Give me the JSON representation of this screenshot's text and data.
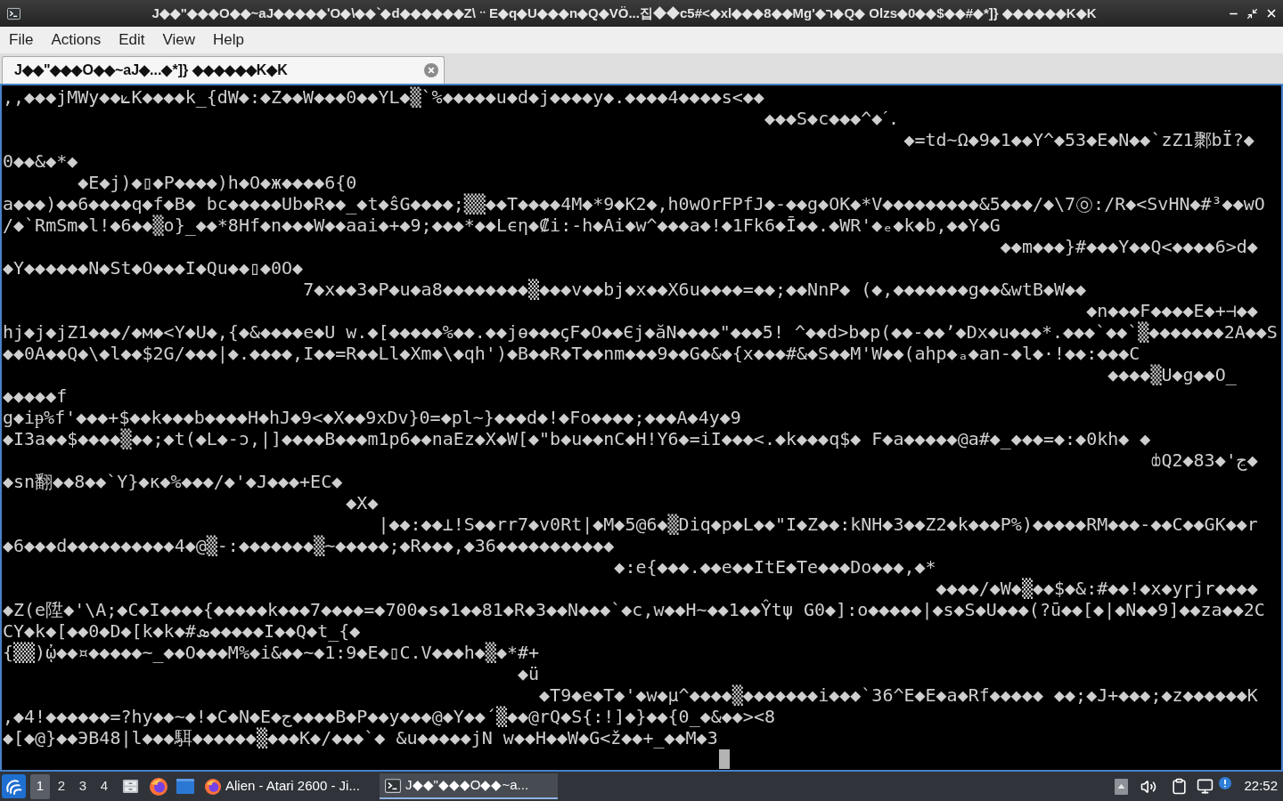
{
  "window": {
    "title": "J◆◆\"◆◆◆O◆◆~aJ◆◆◆◆◆ʹO◆\\◆◆`◆d◆◆◆◆◆◆Z\\ᆢE◆q◆U◆◆◆n◆Q◆VÖ...집◆◆c5#<◆xl◆◆◆8◆◆Mg'◆ר◆Q◆ Olzs◆0◆◆$◆◆#◆*]} ◆◆◆◆◆◆K◆K"
  },
  "menu": [
    "File",
    "Actions",
    "Edit",
    "View",
    "Help"
  ],
  "tabs": [
    {
      "label": "J◆◆\"◆◆◆O◆◆~aJ◆...◆*]} ◆◆◆◆◆◆K◆K",
      "selected": true
    }
  ],
  "terminal": {
    "lines": [
      ",,◆◆◆jMWy◆◆⟀K◆◆◆◆k_{dW◆:◆Z◆◆W◆◆◆0◆◆YL◆▒`%◆◆◆◆◆u◆d◆j◆◆◆◆y◆.◆◆◆◆4◆◆◆◆s<◆◆",
      "                                                                       ◆◆◆S◆c◆◆◆^◆ˊ.",
      "                                                                                    ◆=td~Ω◆9◆1◆◆Y^◆53◆E◆N◆◆`zZ1鄹bÏ?◆",
      "0◆◆&◆*◆",
      "       ◆E◆j)◆▯◆P◆◆◆◆)h◆O◆ж◆◆◆◆6{0",
      "a◆◆◆)◆◆6◆◆◆◆q◆f◆B◆ bc◆◆◆◆◆Ub◆R◆◆_◆t◆ŝG◆◆◆◆;▒▒◆◆T◆◆◆◆4M◆*9◆K2◆,h0wOrFPfJ◆-◆◆g◆OK◆*V◆◆◆◆◆◆◆◆◆&5◆◆◆/◆\\7㉧:/R◆<SvHN◆#³◆◆wO",
      "/◆`RmSm◆l!◆6◆◆▒o}_◆◆*8Hf◆n◆◆◆W◆◆aai◆+◆9;◆◆◆*◆◆Lϵη◆₡i:-h◆Ai◆w^◆◆◆a◆!◆1Fk6◆Ῑ◆◆.◆WR'◆ₑ◆k◆b,◆◆Y◆G",
      "                                                                                             ◆◆m◆◆◆}#◆◆◆Y◆◆Q<◆◆◆◆6>d◆",
      "◆Y◆◆◆◆◆◆N◆St◆O◆◆◆I◆Qu◆◆▯◆0O◆",
      "                            7◆x◆◆3◆P◆u◆a8◆◆◆◆◆◆◆◆▒◆◆◆v◆◆bj◆x◆◆X6u◆◆◆◆=◆◆;◆◆NnP◆ (◆,◆◆◆◆◆◆◆g◆◆&wtB◆W◆◆",
      "                                                                                                     ◆n◆◆◆F◆◆◆◆E◆+⊣◆◆",
      "hj◆j◆jZ1◆◆◆/◆м◆<Y◆U◆,{◆&◆◆◆◆e◆U w.◆[◆◆◆◆◆%◆◆.◆◆jѳ◆◆◆ꞔF◆O◆◆Єj◆ăN◆◆◆◆\"◆◆◆5! ^◆◆d>b◆p(◆◆-◆◆ʼ◆Dx◆u◆◆◆*.◆◆◆`◆◆`▒◆◆◆◆◆◆◆2A◆◆S",
      "◆◆0A◆◆Q◆\\◆l◆◆$2G/◆◆◆|◆.◆◆◆◆,I◆◆=R◆◆Ll◆Xm◆\\◆qh')◆B◆◆R◆T◆◆nm◆◆◆9◆◆G◆&◆{x◆◆◆#&◆S◆◆M'W◆◆(ahp◆ₐ◆an-◆l◆·!◆◆:◆◆◆C",
      "                                                                                                       ◆◆◆◆▒U◆g◆◆O_",
      "◆◆◆◆◆f",
      "g◆iᵽ%f'◆◆◆+$◆◆k◆◆◆b◆◆◆◆H◆hJ◆9<◆X◆◆9xDv}0=◆pl~}◆◆◆d◆!◆Fo◆◆◆◆;◆◆◆A◆4y◆9",
      "◆I3a◆◆$◆◆◆◆▒◆◆;◆t(◆L◆-ͻ,|]◆◆◆◆B◆◆◆m1p6◆◆naEz◆X◆W[◆\"b◆u◆◆nC◆H!Ү6◆=iI◆◆◆<.◆k◆◆◆q$◆ F◆a◆◆◆◆◆@a#◆_◆◆◆=◆:◆0kh◆ ◆",
      "                                                                                                           ȸQ2◆83◆'ڃ◆",
      "◆sn翻◆◆8◆◆`Y}◆κ◆%◆◆◆/◆'◆J◆◆◆+EC◆",
      "                                ◆X◆",
      "                                   |◆◆:◆◆⊥!S◆◆rr7◆v0Rt|◆M◆5@6◆▒Diq◆p◆L◆◆\"I◆Z◆◆:kNH◆3◆◆Z2◆k◆◆◆P%)◆◆◆◆◆RM◆◆◆-◆◆C◆◆GK◆◆r",
      "◆6◆◆◆d◆◆◆◆◆◆◆◆◆◆4◆@▒-:◆◆◆◆◆◆◆▒~◆◆◆◆◆;◆R◆◆◆,◆36◆◆◆◆◆◆◆◆◆◆◆",
      "                                                         ◆:e{◆◆◆.◆◆e◆◆ItE◆Te◆◆◆Do◆◆◆,◆*",
      "                                                                                       ◆◆◆◆/◆W◆▒◆◆$◆&:#◆◆!◆x◆yɼjr◆◆◆◆",
      "◆Z(e陞◆'\\A;◆C◆I◆◆◆◆{◆◆◆◆◆k◆◆◆7◆◆◆◆=◆700◆s◆1◆◆81◆R◆3◆◆N◆◆◆`◆c,w◆◆H~◆◆1◆◆Ŷtψ G0◆]:o◆◆◆◆◆|◆s◆S◆U◆◆◆(?ū◆◆[◆|◆N◆◆9]◆◆za◆◆2C",
      "CY◆k◆[◆◆0◆D◆[k◆k◆#ܣ◆◆◆◆◆I◆◆Q◆t_{◆",
      "{▒▒)ᾠ◆◆¤◆◆◆◆◆~_◆◆O◆◆◆M%◆i&◆◆~◆1:9◆E◆▯C.V◆◆◆h◆▒◆*#+",
      "                                                ◆ü",
      "                                                  ◆T9◆e◆T◆'◆w◆µ^◆◆◆◆▒◆◆◆◆◆◆◆i◆◆◆`36^E◆E◆a◆Rf◆◆◆◆◆ ◆◆;◆J+◆◆◆;◆z◆◆◆◆◆◆K",
      ",◆4!◆◆◆◆◆◆=?hy◆◆~◆!◆C◆N◆E◆ج◆◆◆◆B◆P◆◆y◆◆◆@◆Y◆◆´▒◆◆@rQ◆S{:!]◆}◆◆{0_◆&◆◆><8",
      "◆[◆@}◆◆ЭB48|l◆◆◆駬◆◆◆◆◆◆▒◆◆◆K◆/◆◆◆`◆ &u◆◆◆◆◆jN w◆◆H◆◆W◆G<ž◆◆+_◆◆M◆3"
    ]
  },
  "taskbar": {
    "workspaces": [
      {
        "label": "1",
        "selected": true
      },
      {
        "label": "2",
        "selected": false
      },
      {
        "label": "3",
        "selected": false
      },
      {
        "label": "4",
        "selected": false
      }
    ],
    "tasks": [
      {
        "kind": "browser",
        "label": "Alien - Atari 2600 - Ji...",
        "selected": false
      },
      {
        "kind": "terminal",
        "label": "J◆◆\"◆◆◆O◆◆~a...",
        "selected": true
      }
    ],
    "clock": "22:52"
  }
}
